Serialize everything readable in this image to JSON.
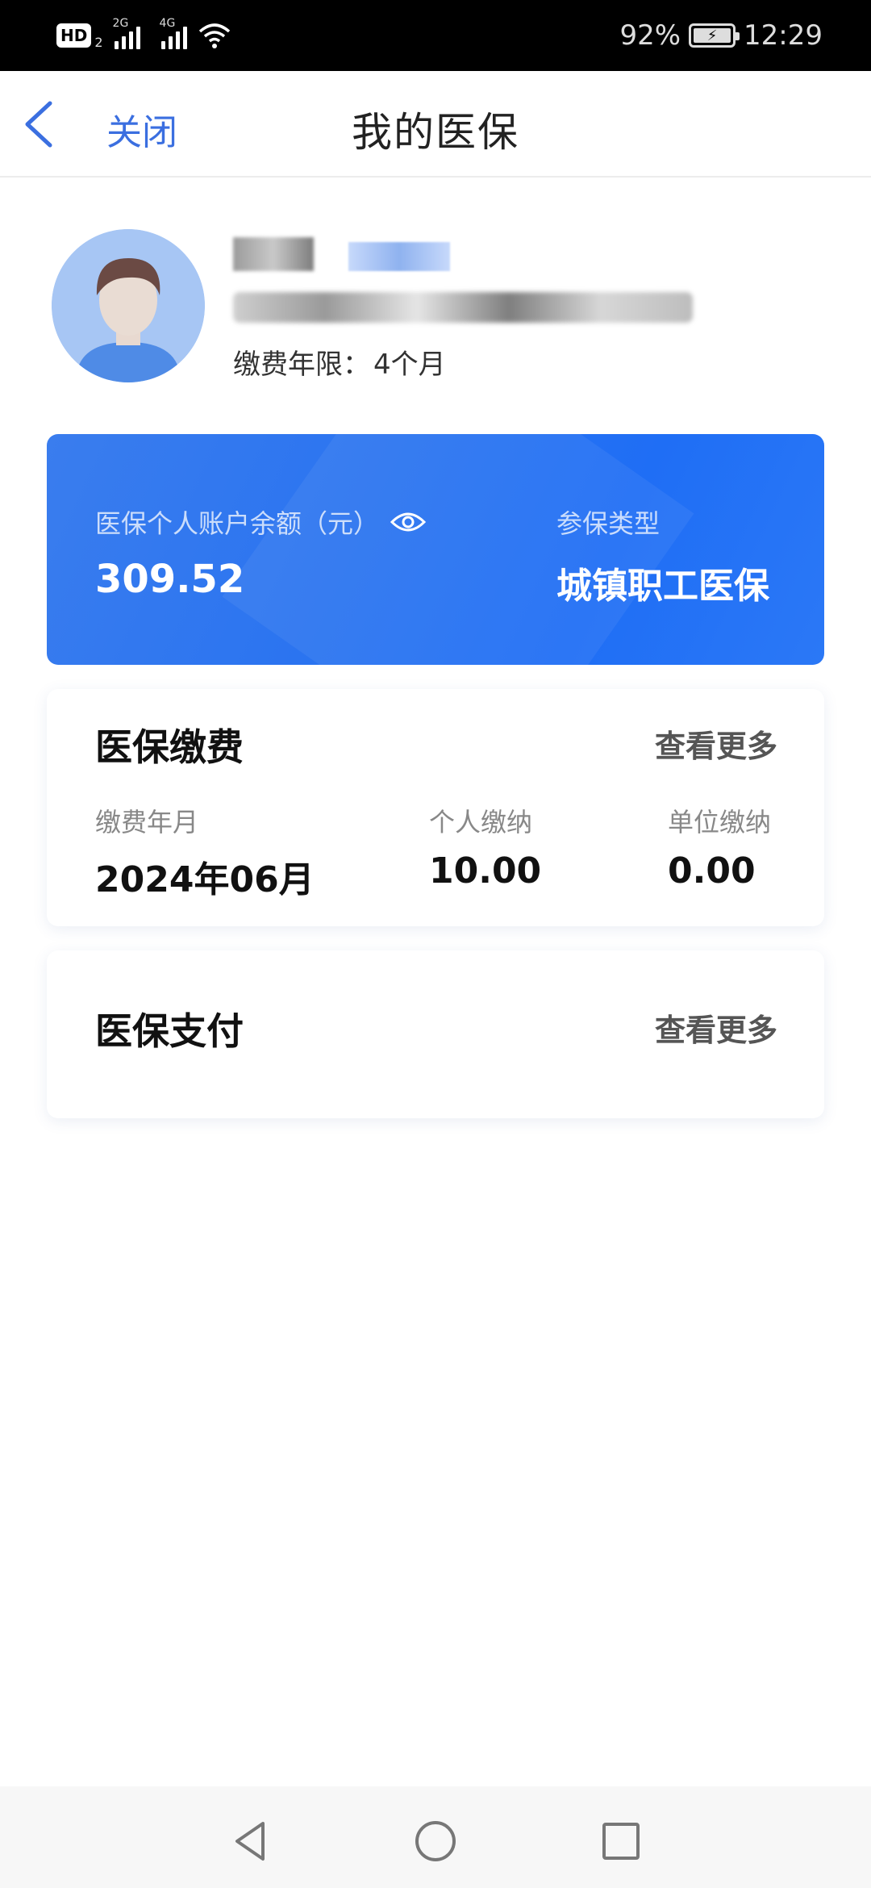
{
  "status_bar": {
    "hd": "HD",
    "hd_sub": "2",
    "net1": "2G",
    "net2": "4G",
    "battery_pct": "92%",
    "time": "12:29"
  },
  "nav": {
    "close_label": "关闭",
    "title": "我的医保"
  },
  "profile": {
    "pay_years_label": "缴费年限：",
    "pay_years_value": "4个月"
  },
  "balance_card": {
    "balance_label": "医保个人账户余额（元）",
    "balance_value": "309.52",
    "insurance_type_label": "参保类型",
    "insurance_type_value": "城镇职工医保"
  },
  "payment_card": {
    "title": "医保缴费",
    "more": "查看更多",
    "columns": [
      {
        "label": "缴费年月",
        "value": "2024年06月"
      },
      {
        "label": "个人缴纳",
        "value": "10.00"
      },
      {
        "label": "单位缴纳",
        "value": "0.00"
      }
    ]
  },
  "pay_card": {
    "title": "医保支付",
    "more": "查看更多"
  },
  "icons": {
    "back": "chevron-left-icon",
    "eye": "eye-icon",
    "nav_back": "triangle-back-icon",
    "nav_home": "circle-home-icon",
    "nav_recent": "square-recent-icon"
  },
  "colors": {
    "accent": "#3b6fe0",
    "card_blue": "#2a72f2"
  }
}
